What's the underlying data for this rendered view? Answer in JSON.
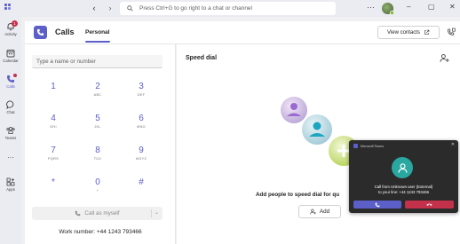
{
  "titlebar": {
    "search_placeholder": "Press Ctrl+G to go right to a chat or channel",
    "more_label": "···",
    "minimize": "–",
    "maximize": "▢",
    "close": "✕"
  },
  "rail": {
    "items": [
      {
        "label": "Activity",
        "icon": "bell-icon",
        "badge": "1"
      },
      {
        "label": "Calendar",
        "icon": "calendar-icon"
      },
      {
        "label": "Calls",
        "icon": "phone-icon",
        "active": true
      },
      {
        "label": "Chat",
        "icon": "chat-icon"
      },
      {
        "label": "Teams",
        "icon": "teams-icon"
      },
      {
        "label": "···",
        "icon": "more-icon"
      },
      {
        "label": "Apps",
        "icon": "apps-icon"
      }
    ]
  },
  "header": {
    "title": "Calls",
    "tab": "Personal",
    "view_contacts": "View contacts"
  },
  "dialpad": {
    "input_placeholder": "Type a name or number",
    "keys": [
      {
        "digit": "1",
        "sub": ""
      },
      {
        "digit": "2",
        "sub": "ABC"
      },
      {
        "digit": "3",
        "sub": "DEF"
      },
      {
        "digit": "4",
        "sub": "GHI"
      },
      {
        "digit": "5",
        "sub": "JKL"
      },
      {
        "digit": "6",
        "sub": "MNO"
      },
      {
        "digit": "7",
        "sub": "PQRS"
      },
      {
        "digit": "8",
        "sub": "TUV"
      },
      {
        "digit": "9",
        "sub": "WXYZ"
      },
      {
        "digit": "*",
        "sub": ""
      },
      {
        "digit": "0",
        "sub": "+"
      },
      {
        "digit": "#",
        "sub": ""
      }
    ],
    "call_button": "Call as myself",
    "work_number": "Work number: +44 1243 793466"
  },
  "speed_dial": {
    "title": "Speed dial",
    "empty_text": "Add people to speed dial for qu",
    "add_button": "Add"
  },
  "toast": {
    "header": "Microsoft Teams",
    "line1": "Call from Unknown user (External)",
    "line2": "to your line: +44 1243 793466"
  },
  "colors": {
    "accent": "#5b5fc7",
    "decline": "#c4314b",
    "caller_avatar": "#2aa7a0"
  }
}
